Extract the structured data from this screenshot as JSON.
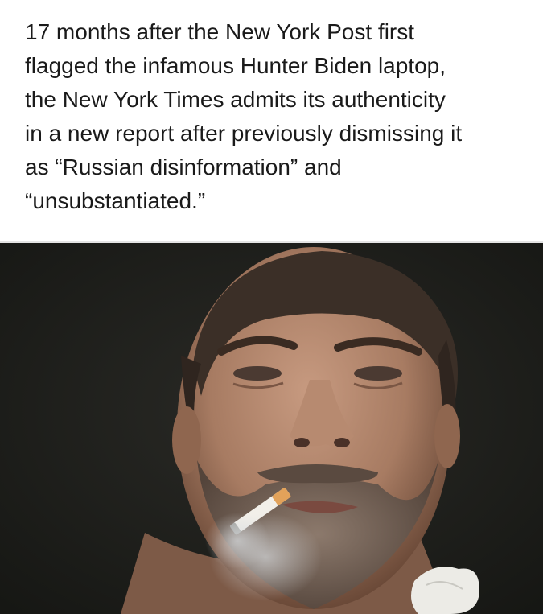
{
  "caption": {
    "text": "17 months after the New York Post first\nflagged the infamous Hunter Biden laptop,\nthe New York Times admits its authenticity\nin a new report after previously dismissing it\nas “Russian disinformation” and\n“unsubstantiated.”"
  },
  "photo": {
    "subject": "close-up portrait of a man with a cigarette in his mouth",
    "colors": {
      "background": "#1c1d1a",
      "skin": "#a77b62",
      "hair": "#3b2f27"
    }
  }
}
